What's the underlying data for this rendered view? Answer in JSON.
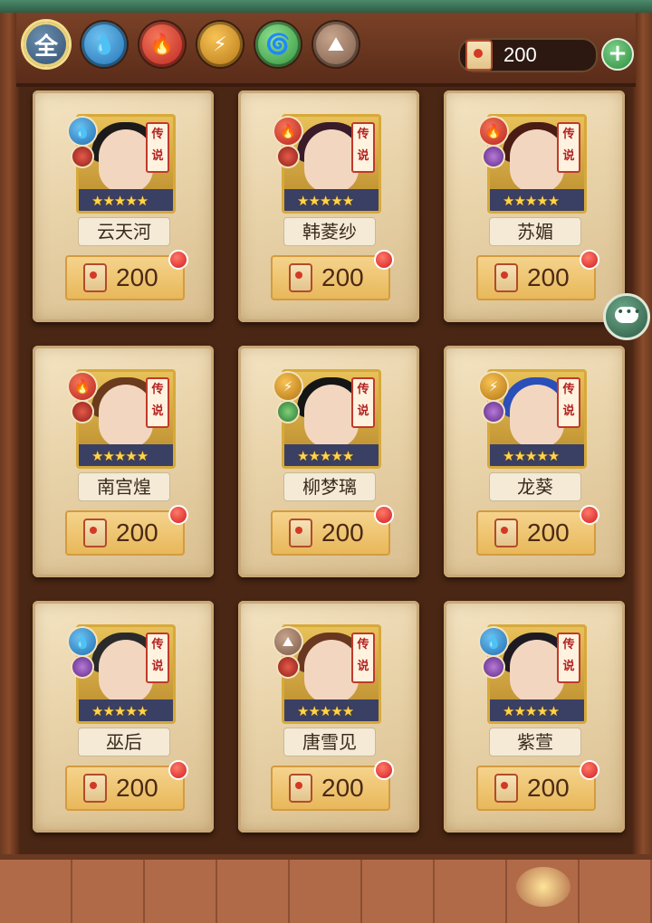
{
  "tabs": [
    {
      "label": "全",
      "icon": "all-tab",
      "active": true
    },
    {
      "label": "💧",
      "icon": "water-icon",
      "active": false
    },
    {
      "label": "🔥",
      "icon": "fire-icon",
      "active": false
    },
    {
      "label": "⚡",
      "icon": "thunder-icon",
      "active": false
    },
    {
      "label": "🌀",
      "icon": "wind-icon",
      "active": false
    },
    {
      "label": "⛰",
      "icon": "earth-icon",
      "active": false
    }
  ],
  "currency": {
    "amount": "200",
    "add_label": "+"
  },
  "legend_label": "传说",
  "cards": [
    {
      "name": "云天河",
      "price": "200",
      "element": "water",
      "element_glyph": "💧",
      "class": "red",
      "hair": "#1d1a1a",
      "stars": "★★★★★"
    },
    {
      "name": "韩菱纱",
      "price": "200",
      "element": "fire",
      "element_glyph": "🔥",
      "class": "red",
      "hair": "#3a1b2a",
      "stars": "★★★★★"
    },
    {
      "name": "苏媚",
      "price": "200",
      "element": "fire",
      "element_glyph": "🔥",
      "class": "purple",
      "hair": "#4a1c14",
      "stars": "★★★★★"
    },
    {
      "name": "南宫煌",
      "price": "200",
      "element": "fire",
      "element_glyph": "🔥",
      "class": "red",
      "hair": "#6a3b1c",
      "stars": "★★★★★"
    },
    {
      "name": "柳梦璃",
      "price": "200",
      "element": "thunder",
      "element_glyph": "⚡",
      "class": "green",
      "hair": "#151515",
      "stars": "★★★★★"
    },
    {
      "name": "龙葵",
      "price": "200",
      "element": "thunder",
      "element_glyph": "⚡",
      "class": "purple",
      "hair": "#2a4fb8",
      "stars": "★★★★★"
    },
    {
      "name": "巫后",
      "price": "200",
      "element": "water",
      "element_glyph": "💧",
      "class": "purple",
      "hair": "#2a2a2a",
      "stars": "★★★★★"
    },
    {
      "name": "唐雪见",
      "price": "200",
      "element": "earth",
      "element_glyph": "⛰",
      "class": "red",
      "hair": "#6a3820",
      "stars": "★★★★★"
    },
    {
      "name": "紫萱",
      "price": "200",
      "element": "water",
      "element_glyph": "💧",
      "class": "purple",
      "hair": "#1e1a22",
      "stars": "★★★★★"
    }
  ]
}
